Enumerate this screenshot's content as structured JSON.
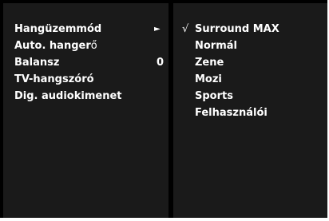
{
  "left_menu": {
    "items": [
      {
        "label": "Hangüzemmód",
        "label_thin": "",
        "value": "",
        "icon": "right-triangle-icon",
        "arrow": "►"
      },
      {
        "label": "Auto. hanger",
        "label_thin": "ő",
        "value": ""
      },
      {
        "label": "Balansz",
        "label_thin": "",
        "value": "0"
      },
      {
        "label": "TV-hangszóró",
        "label_thin": "",
        "value": ""
      },
      {
        "label": "Dig. audiokimenet",
        "label_thin": "",
        "value": ""
      }
    ]
  },
  "right_menu": {
    "check_symbol": "√",
    "options": [
      {
        "label": "Surround MAX",
        "selected": true
      },
      {
        "label": "Normál",
        "selected": false
      },
      {
        "label": "Zene",
        "selected": false
      },
      {
        "label": "Mozi",
        "selected": false
      },
      {
        "label": "Sports",
        "selected": false
      },
      {
        "label": "Felhasználói",
        "selected": false
      }
    ]
  },
  "colors": {
    "background": "#1a1a1a",
    "border": "#000000",
    "text": "#ffffff"
  }
}
